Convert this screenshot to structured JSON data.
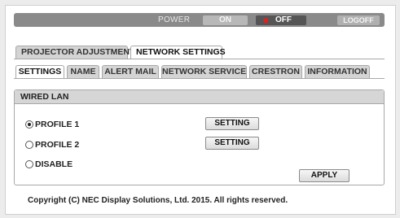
{
  "powerbar": {
    "power_label": "POWER",
    "on_label": "ON",
    "off_label": "OFF",
    "logoff_label": "LOGOFF",
    "off_indicator_color": "#e02020"
  },
  "top_tabs": {
    "projector_adjustment": "PROJECTOR ADJUSTMENT",
    "network_settings": "NETWORK SETTINGS",
    "active": "NETWORK SETTINGS"
  },
  "sub_tabs": {
    "settings": "SETTINGS",
    "name": "NAME",
    "alert_mail": "ALERT MAIL",
    "network_service": "NETWORK SERVICE",
    "crestron": "CRESTRON",
    "information": "INFORMATION",
    "active": "SETTINGS"
  },
  "wired_lan": {
    "title": "WIRED LAN",
    "profile1_label": "PROFILE 1",
    "profile2_label": "PROFILE 2",
    "disable_label": "DISABLE",
    "selected": "PROFILE 1",
    "setting_button_1": "SETTING",
    "setting_button_2": "SETTING",
    "apply_button": "APPLY"
  },
  "footer": {
    "copyright": "Copyright (C) NEC Display Solutions, Ltd. 2015. All rights reserved."
  }
}
